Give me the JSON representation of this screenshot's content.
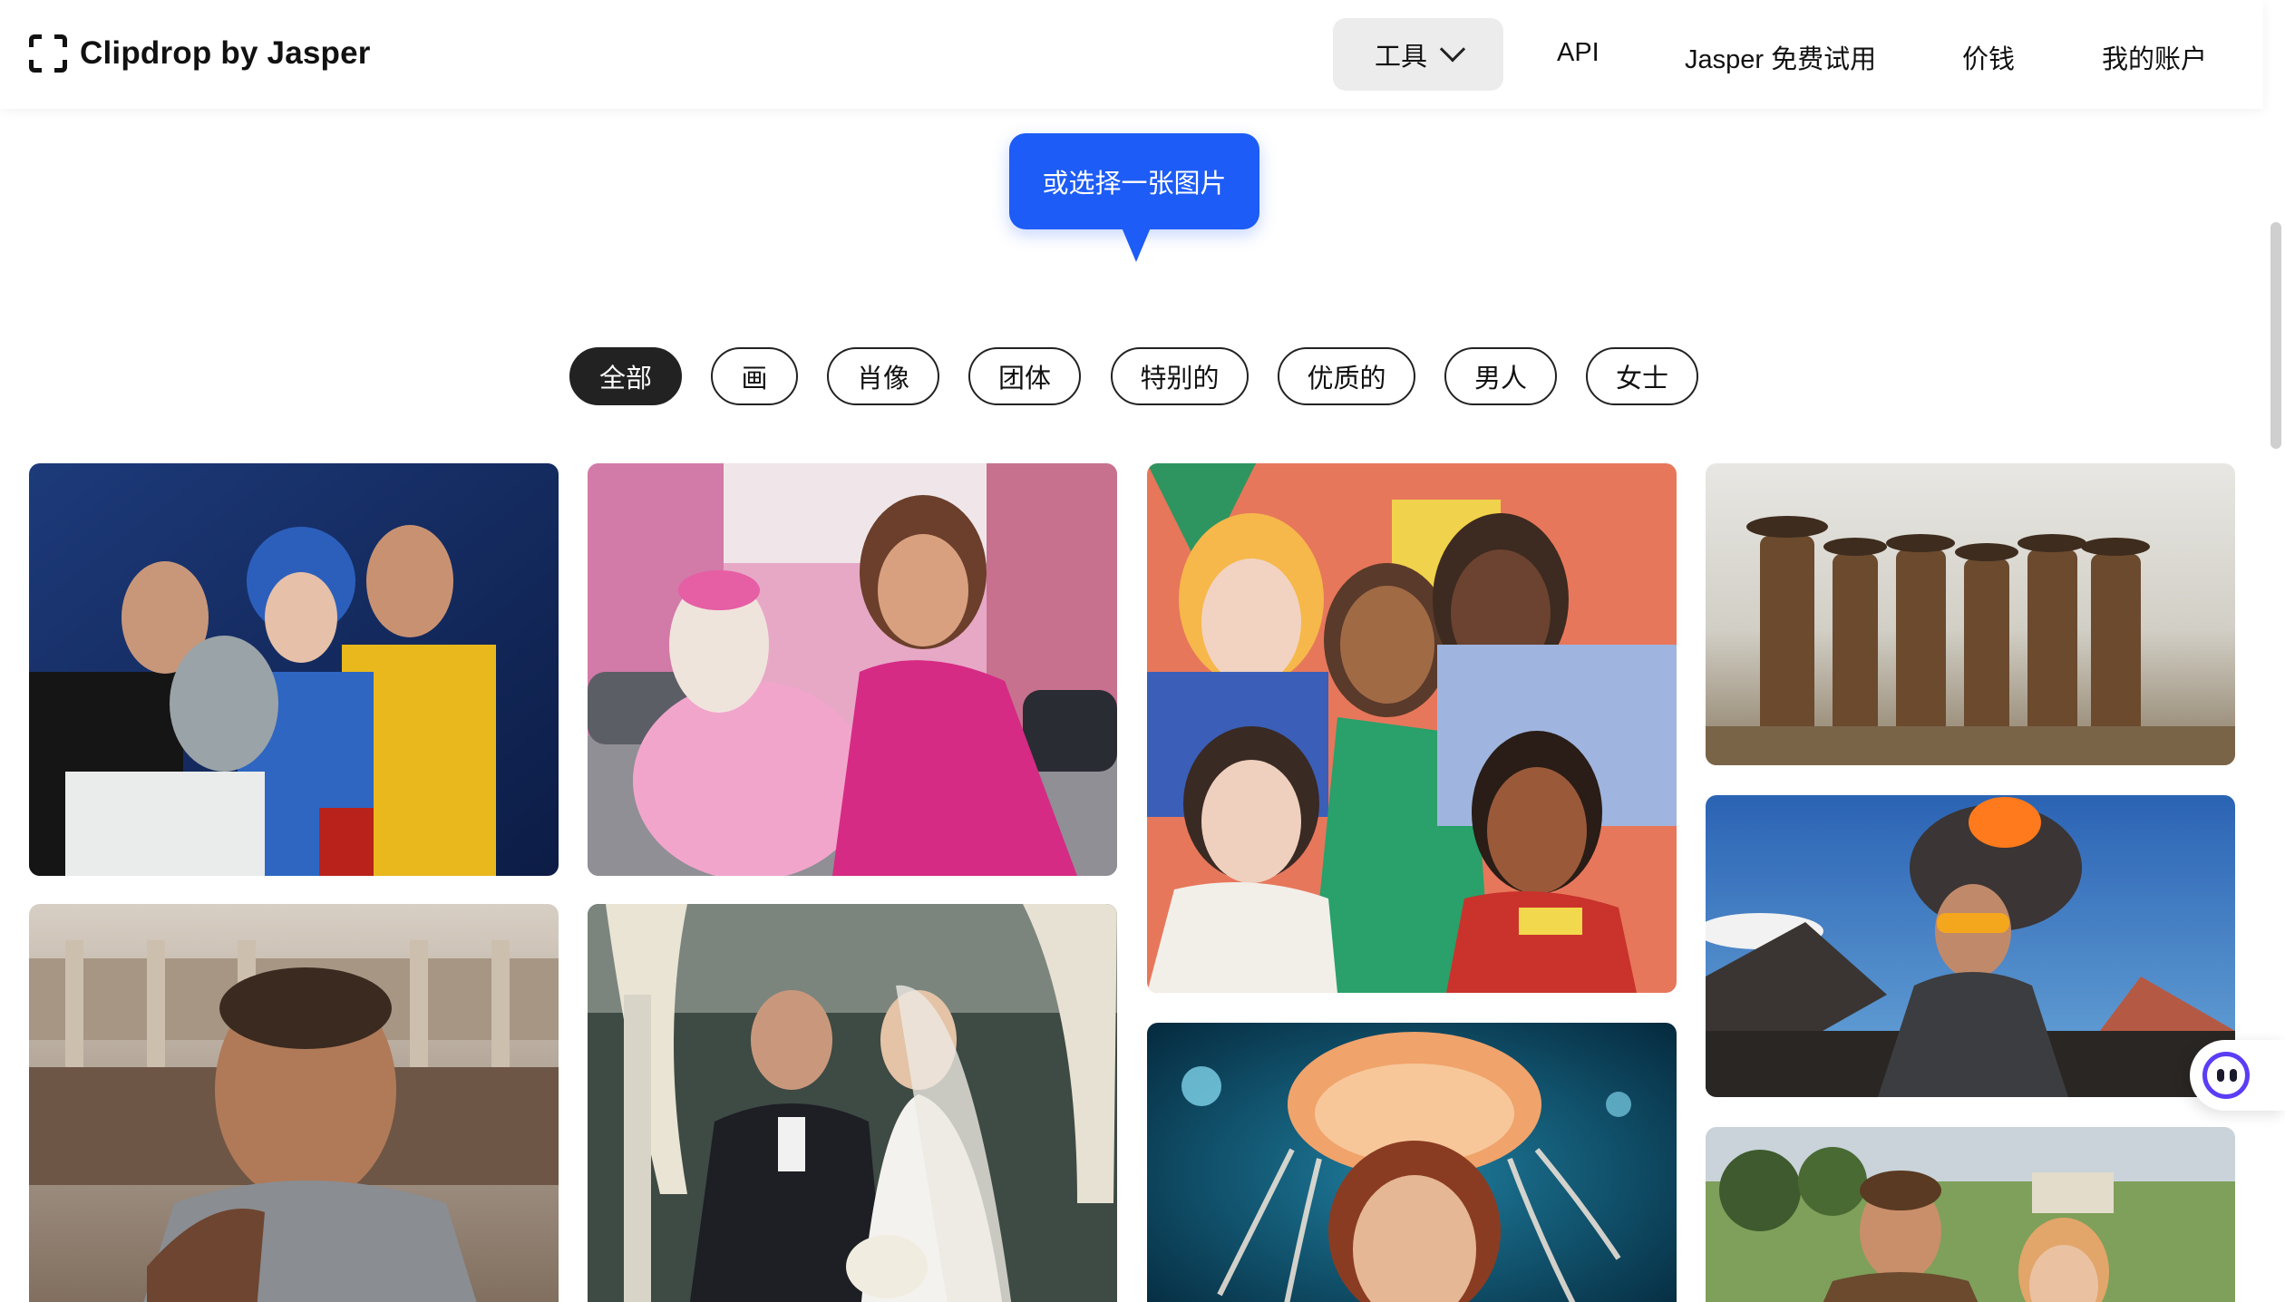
{
  "header": {
    "brand": "Clipdrop by Jasper",
    "nav": {
      "tools": "工具",
      "api": "API",
      "trial": "Jasper 免费试用",
      "pricing": "价钱",
      "account": "我的账户"
    }
  },
  "tooltip": {
    "label": "或选择一张图片"
  },
  "filters": [
    {
      "label": "全部",
      "active": true
    },
    {
      "label": "画",
      "active": false
    },
    {
      "label": "肖像",
      "active": false
    },
    {
      "label": "团体",
      "active": false
    },
    {
      "label": "特别的",
      "active": false
    },
    {
      "label": "优质的",
      "active": false
    },
    {
      "label": "男人",
      "active": false
    },
    {
      "label": "女士",
      "active": false
    }
  ],
  "gallery_icons": [
    "retro-group-photo",
    "woman-with-pink-llama",
    "painted-group-portrait",
    "cowboys-group-photo",
    "gladiator-portrait",
    "wedding-couple",
    "woman-with-jellyfish-hat",
    "volcano-selfie",
    "man-and-woman-in-countryside"
  ],
  "colors": {
    "accent": "#1d5cf6",
    "chip_active_bg": "#222222",
    "chat_accent": "#5b3df5"
  }
}
